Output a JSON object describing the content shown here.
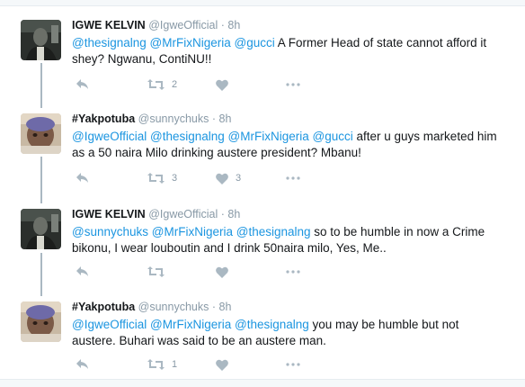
{
  "colors": {
    "mention": "#1b95e0",
    "meta": "#8899a6",
    "icon": "#aab8c2",
    "text": "#14171a"
  },
  "icons": {
    "reply": "reply-icon",
    "retweet": "retweet-icon",
    "like": "heart-icon",
    "more": "more-icon"
  },
  "tweets": [
    {
      "name": "IGWE KELVIN",
      "handle": "@IgweOfficial",
      "sep": "·",
      "time": "8h",
      "mentions": [
        "@thesignalng",
        "@MrFixNigeria",
        "@gucci"
      ],
      "text_line1": " A Former Head of state cannot afford it",
      "text_line2": "shey? Ngwanu, ContiNU!!",
      "retweets": "2",
      "likes": ""
    },
    {
      "name": "#Yakpotuba",
      "handle": "@sunnychuks",
      "sep": "·",
      "time": "8h",
      "mentions": [
        "@IgweOfficial",
        "@thesignalng",
        "@MrFixNigeria",
        "@gucci"
      ],
      "text_line1": " after u guys marketed him",
      "text_line2": "as a 50 naira Milo drinking austere president? Mbanu!",
      "retweets": "3",
      "likes": "3"
    },
    {
      "name": "IGWE KELVIN",
      "handle": "@IgweOfficial",
      "sep": "·",
      "time": "8h",
      "mentions": [
        "@sunnychuks",
        "@MrFixNigeria",
        "@thesignalng"
      ],
      "text_line1": " so to be humble in now a Crime",
      "text_line2": "bikonu, I wear louboutin and I drink 50naira milo, Yes, Me..",
      "retweets": "",
      "likes": ""
    },
    {
      "name": "#Yakpotuba",
      "handle": "@sunnychuks",
      "sep": "·",
      "time": "8h",
      "mentions": [
        "@IgweOfficial",
        "@MrFixNigeria",
        "@thesignalng"
      ],
      "text_line1": " you may be humble but not",
      "text_line2": "austere. Buhari was said to be an austere man.",
      "retweets": "1",
      "likes": ""
    }
  ]
}
